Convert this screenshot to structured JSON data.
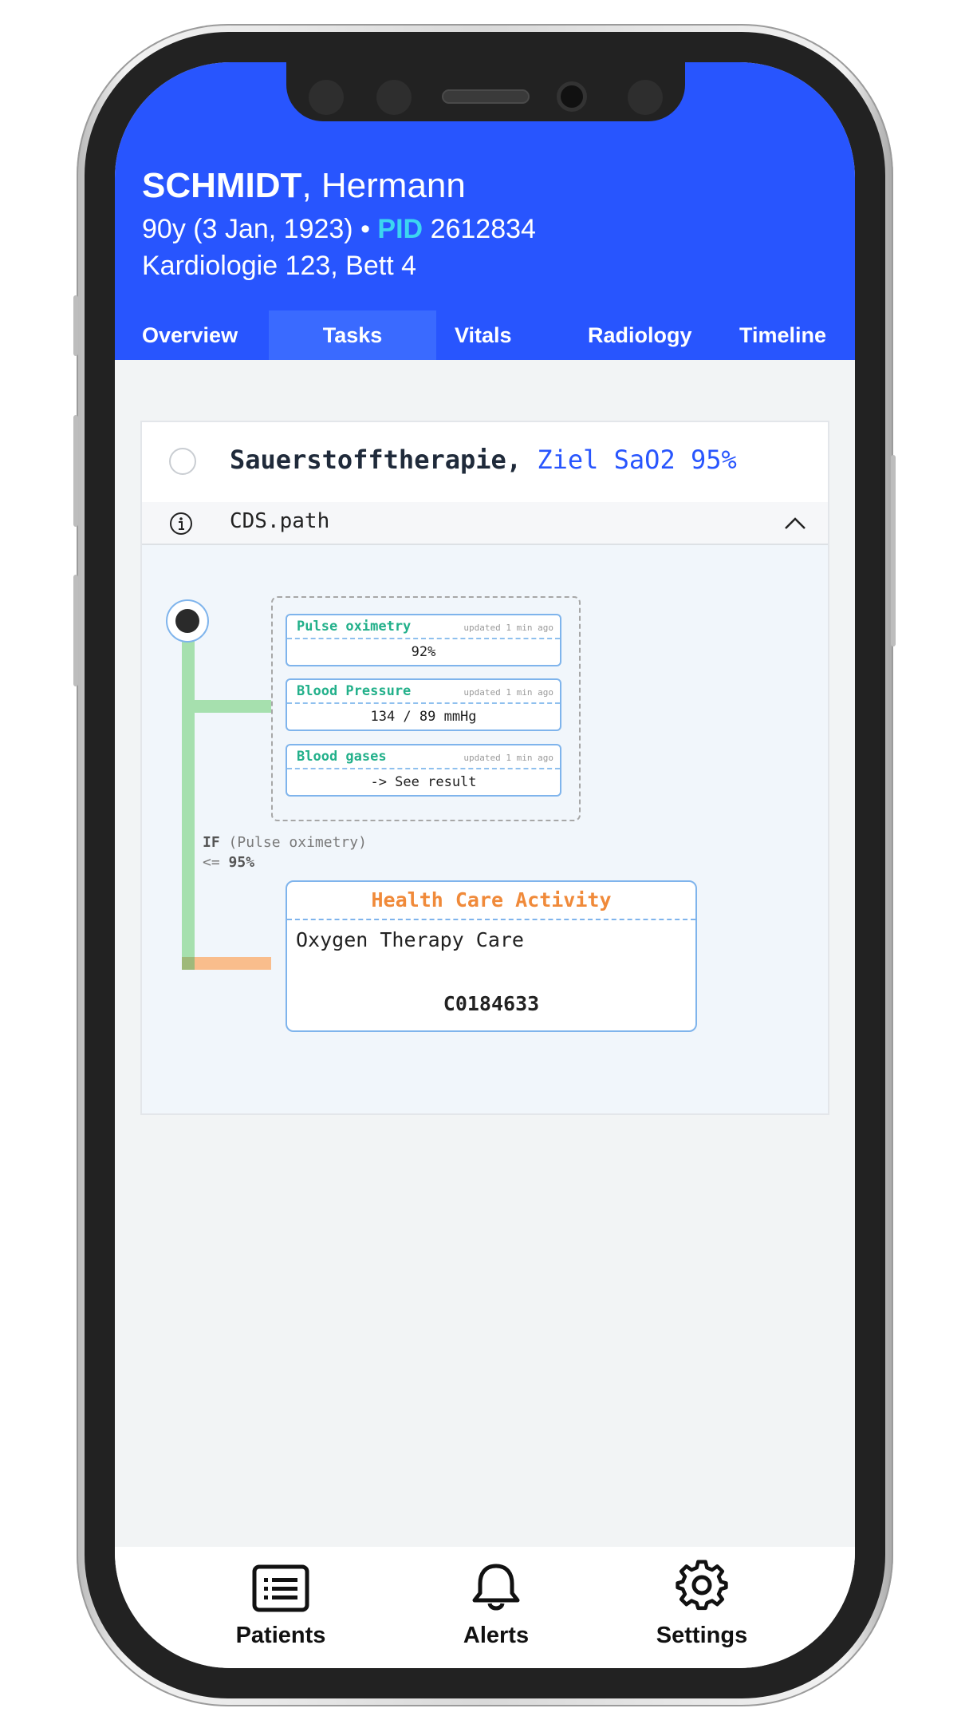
{
  "patient": {
    "last_name": "SCHMIDT",
    "first_name": "Hermann",
    "age_dob": "90y (3 Jan, 1923)",
    "pid_label": "PID",
    "pid": "2612834",
    "location": "Kardiologie 123, Bett 4"
  },
  "tabs": [
    {
      "label": "Overview",
      "active": false
    },
    {
      "label": "Tasks",
      "active": true
    },
    {
      "label": "Vitals",
      "active": false
    },
    {
      "label": "Radiology",
      "active": false
    },
    {
      "label": "Timeline",
      "active": false
    }
  ],
  "task": {
    "title": "Sauerstofftherapie,",
    "goal": "Ziel SaO2 95%",
    "cds_label": "CDS.path"
  },
  "flow": {
    "observations": [
      {
        "name": "Pulse oximetry",
        "updated": "updated 1 min ago",
        "value": "92%"
      },
      {
        "name": "Blood Pressure",
        "updated": "updated 1 min ago",
        "value": "134 / 89 mmHg"
      },
      {
        "name": "Blood gases",
        "updated": "updated 1 min ago",
        "value": "-> See result"
      }
    ],
    "condition": {
      "keyword": "IF",
      "subject": "(Pulse oximetry)",
      "operator": "<=",
      "threshold": "95%"
    },
    "activity": {
      "title": "Health Care Activity",
      "description": "Oxygen Therapy Care",
      "code": "C0184633"
    }
  },
  "bottom_nav": [
    {
      "label": "Patients",
      "icon": "patients-list-icon"
    },
    {
      "label": "Alerts",
      "icon": "bell-icon"
    },
    {
      "label": "Settings",
      "icon": "gear-icon"
    }
  ],
  "colors": {
    "header": "#2855fe",
    "pid": "#3cd6f0",
    "goal": "#2855fe",
    "observation_name": "#22b08a",
    "activity_title": "#f08a3a",
    "path_green": "#a6e0ae",
    "path_orange": "#f9bd8c"
  }
}
